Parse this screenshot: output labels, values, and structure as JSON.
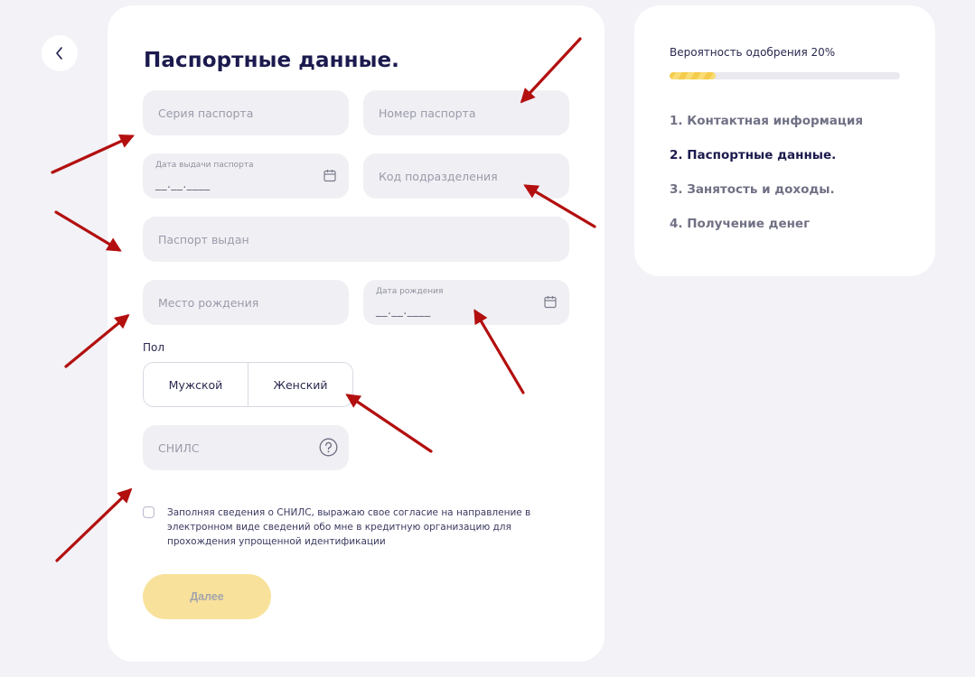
{
  "form": {
    "title": "Паспортные данные.",
    "series_placeholder": "Серия паспорта",
    "number_placeholder": "Номер паспорта",
    "issue_date_label": "Дата выдачи паспорта",
    "issue_date_mask": "__.__.____",
    "division_code_placeholder": "Код подразделения",
    "issued_by_placeholder": "Паспорт выдан",
    "birthplace_placeholder": "Место рождения",
    "birthdate_label": "Дата рождения",
    "birthdate_mask": "__.__.____",
    "gender_label": "Пол",
    "gender_male": "Мужской",
    "gender_female": "Женский",
    "snils_placeholder": "СНИЛС",
    "consent_text": "Заполняя сведения о СНИЛС, выражаю свое согласие на направление в электронном виде сведений обо мне в кредитную организацию для прохождения упрощенной идентификации",
    "next_label": "Далее"
  },
  "sidebar": {
    "probability_text": "Вероятность одобрения 20%",
    "probability_value": 0.2,
    "steps": [
      {
        "label": "1. Контактная информация",
        "active": false
      },
      {
        "label": "2. Паспортные данные.",
        "active": true
      },
      {
        "label": "3. Занятость и доходы.",
        "active": false
      },
      {
        "label": "4. Получение денег",
        "active": false
      }
    ]
  },
  "colors": {
    "accent_yellow": "#f8e29b",
    "progress_yellow": "#f5cb4c",
    "annotation_arrow": "#b30f0f",
    "title": "#1b1a4e"
  },
  "icons": {
    "back": "chevron-left-icon",
    "calendar": "calendar-icon",
    "help": "question-circle-icon"
  }
}
